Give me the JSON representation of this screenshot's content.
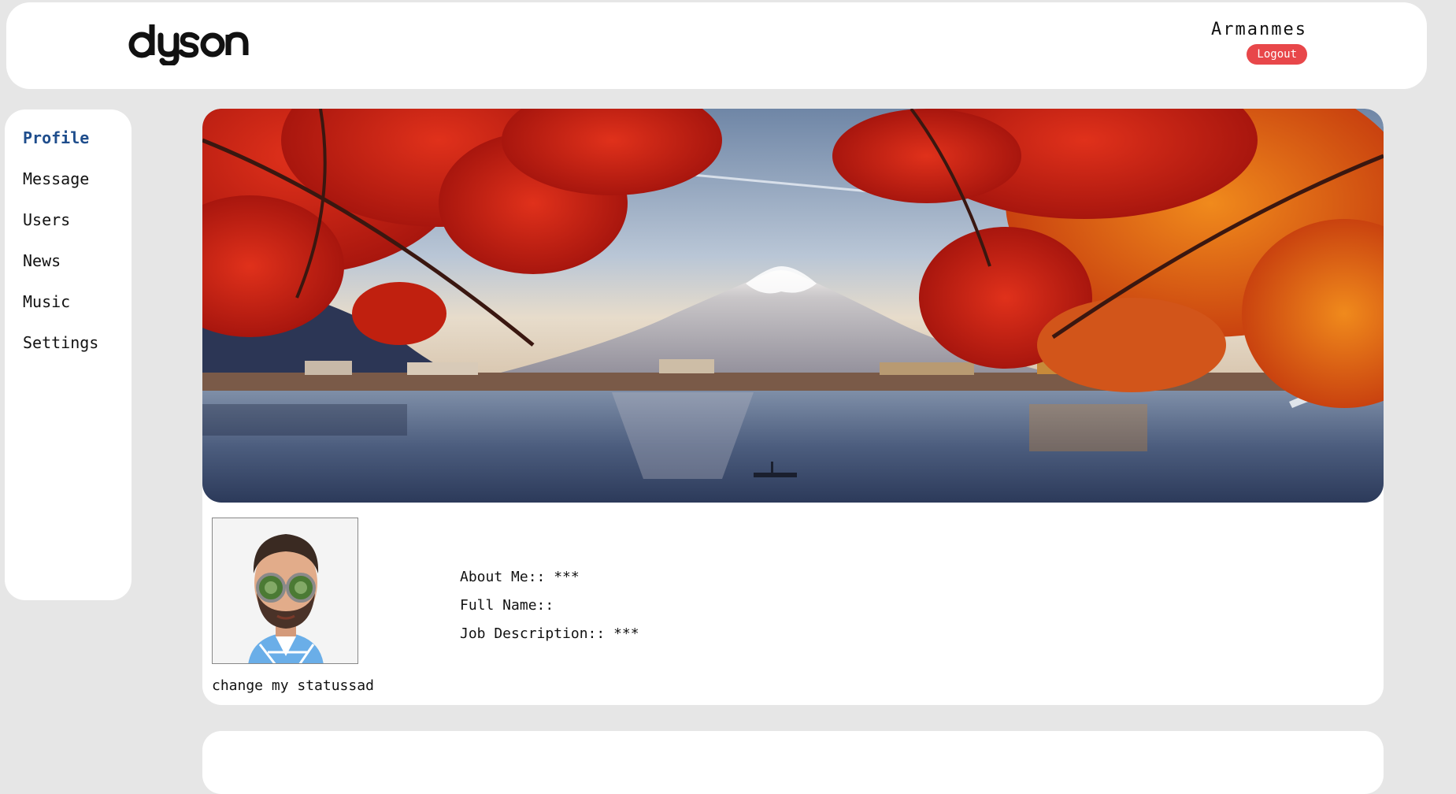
{
  "header": {
    "brand": "dyson",
    "username": "Armanmes",
    "logout_label": "Logout"
  },
  "sidebar": {
    "items": [
      {
        "label": "Profile",
        "active": true
      },
      {
        "label": "Message",
        "active": false
      },
      {
        "label": "Users",
        "active": false
      },
      {
        "label": "News",
        "active": false
      },
      {
        "label": "Music",
        "active": false
      },
      {
        "label": "Settings",
        "active": false
      }
    ]
  },
  "profile": {
    "status": "change my statussad",
    "about_me": "About Me:: ***",
    "full_name": "Full Name::",
    "job_description": "Job Description:: ***"
  },
  "colors": {
    "page_bg": "#e6e6e6",
    "card_bg": "#ffffff",
    "active_nav": "#1e4d8c",
    "logout_bg": "#e8474a"
  }
}
